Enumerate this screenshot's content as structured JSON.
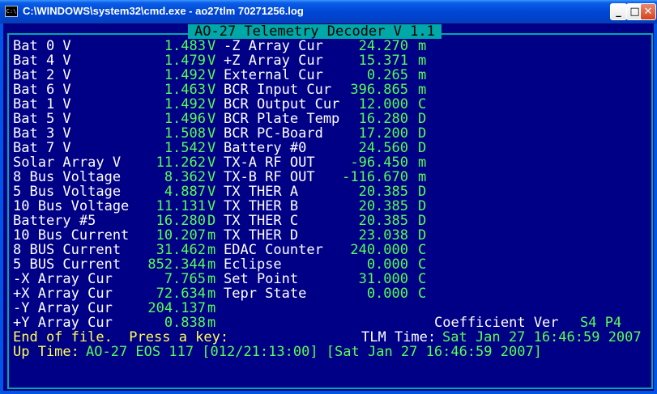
{
  "window": {
    "title": "C:\\WINDOWS\\system32\\cmd.exe - ao27tlm 70271256.log",
    "icon": "cmd-icon",
    "icon_text": "C:\\",
    "min": "_",
    "max": "□",
    "close": "✕"
  },
  "header": "AO-27 Telemetry Decoder V 1.1",
  "left": [
    {
      "label": "Bat 0 V",
      "value": "1.483",
      "unit": "V"
    },
    {
      "label": "Bat 4 V",
      "value": "1.479",
      "unit": "V"
    },
    {
      "label": "Bat 2 V",
      "value": "1.492",
      "unit": "V"
    },
    {
      "label": "Bat 6 V",
      "value": "1.463",
      "unit": "V"
    },
    {
      "label": "Bat 1 V",
      "value": "1.492",
      "unit": "V"
    },
    {
      "label": "Bat 5 V",
      "value": "1.496",
      "unit": "V"
    },
    {
      "label": "Bat 3 V",
      "value": "1.508",
      "unit": "V"
    },
    {
      "label": "Bat 7 V",
      "value": "1.542",
      "unit": "V"
    },
    {
      "label": "Solar Array V",
      "value": "11.262",
      "unit": "V"
    },
    {
      "label": "8 Bus Voltage",
      "value": "8.362",
      "unit": "V"
    },
    {
      "label": "5 Bus Voltage",
      "value": "4.887",
      "unit": "V"
    },
    {
      "label": "10 Bus Voltage",
      "value": "11.131",
      "unit": "V"
    },
    {
      "label": "Battery #5",
      "value": "16.280",
      "unit": "D"
    },
    {
      "label": "10 Bus Current",
      "value": "10.207",
      "unit": "m"
    },
    {
      "label": "8 BUS Current",
      "value": "31.462",
      "unit": "m"
    },
    {
      "label": "5 BUS Current",
      "value": "852.344",
      "unit": "m"
    },
    {
      "label": "-X Array Cur",
      "value": "7.765",
      "unit": "m"
    },
    {
      "label": "+X Array Cur",
      "value": "72.634",
      "unit": "m"
    },
    {
      "label": "-Y Array Cur",
      "value": "204.137",
      "unit": "m"
    },
    {
      "label": "+Y Array Cur",
      "value": "0.838",
      "unit": "m"
    }
  ],
  "right": [
    {
      "label": "-Z Array Cur",
      "value": "24.270",
      "unit": "m"
    },
    {
      "label": "+Z Array Cur",
      "value": "15.371",
      "unit": "m"
    },
    {
      "label": "External Cur",
      "value": "0.265",
      "unit": "m"
    },
    {
      "label": "BCR Input Cur",
      "value": "396.865",
      "unit": "m"
    },
    {
      "label": "BCR Output Cur",
      "value": "12.000",
      "unit": "C"
    },
    {
      "label": "BCR Plate Temp",
      "value": "16.280",
      "unit": "D"
    },
    {
      "label": "BCR PC-Board",
      "value": "17.200",
      "unit": "D"
    },
    {
      "label": "Battery #0",
      "value": "24.560",
      "unit": "D"
    },
    {
      "label": "TX-A RF OUT",
      "value": "-96.450",
      "unit": "m"
    },
    {
      "label": "TX-B RF OUT",
      "value": "-116.670",
      "unit": "m"
    },
    {
      "label": "TX THER A",
      "value": "20.385",
      "unit": "D"
    },
    {
      "label": "TX THER B",
      "value": "20.385",
      "unit": "D"
    },
    {
      "label": "TX THER C",
      "value": "20.385",
      "unit": "D"
    },
    {
      "label": "TX THER D",
      "value": "23.038",
      "unit": "D"
    },
    {
      "label": "EDAC Counter",
      "value": "240.000",
      "unit": "C"
    },
    {
      "label": "Eclipse",
      "value": "0.000",
      "unit": "C"
    },
    {
      "label": "Set Point",
      "value": "31.000",
      "unit": "C"
    },
    {
      "label": "Tepr State",
      "value": "0.000",
      "unit": "C"
    }
  ],
  "coef_label": "Coefficient Ver",
  "coef_value": "S4 P4",
  "end_prompt": "End of file.  Press a key:",
  "tlm_label": "TLM Time:",
  "tlm_value": "Sat Jan 27 16:46:59 2007",
  "uptime_label": "Up Time:",
  "uptime_value": "AO-27 EOS 117 [012/21:13:00] [Sat Jan 27 16:46:59 2007]"
}
